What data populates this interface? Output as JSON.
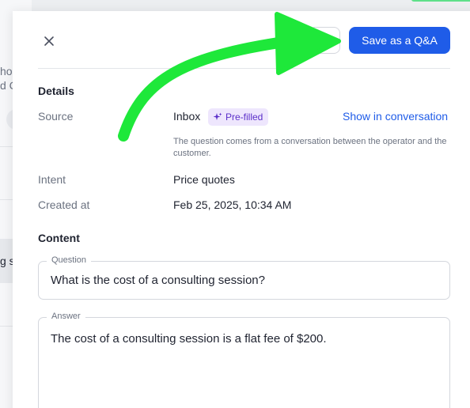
{
  "background": {
    "fragment_1": "ho",
    "fragment_2": "d C",
    "fragment_3": "g s"
  },
  "header": {
    "save_label": "Save as a Q&A"
  },
  "details": {
    "title": "Details",
    "source": {
      "label": "Source",
      "value": "Inbox",
      "badge": "Pre-filled",
      "link": "Show in conversation",
      "helper": "The question comes from a conversation between the operator and the customer."
    },
    "intent": {
      "label": "Intent",
      "value": "Price quotes"
    },
    "created": {
      "label": "Created at",
      "value": "Feb 25, 2025, 10:34 AM"
    }
  },
  "content": {
    "title": "Content",
    "question": {
      "legend": "Question",
      "value": "What is the cost of a consulting session?"
    },
    "answer": {
      "legend": "Answer",
      "value": "The cost of a consulting session is a flat fee of $200."
    }
  },
  "colors": {
    "accent": "#1f5ce8",
    "badge_bg": "#eee6fd",
    "badge_text": "#5b2fc9",
    "annotation_arrow": "#1ee83a"
  },
  "icons": {
    "close": "close-icon",
    "sparkle": "sparkle-icon",
    "arrow": "annotation-arrow-icon"
  }
}
